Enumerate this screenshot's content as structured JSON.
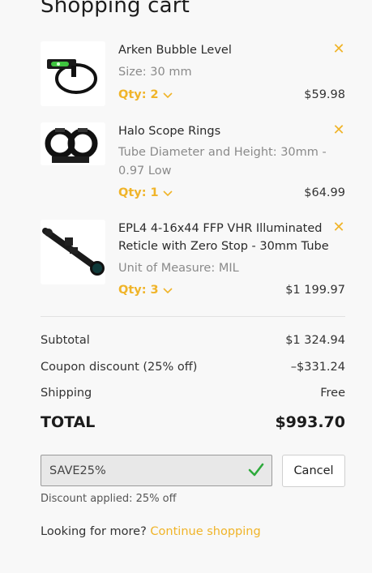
{
  "page": {
    "title": "Shopping cart"
  },
  "colors": {
    "accent": "#f0b429",
    "success": "#2eaa3c"
  },
  "cart": {
    "items": [
      {
        "name": "Arken Bubble Level",
        "attribute": "Size: 30 mm",
        "qty_label": "Qty: 2",
        "price": "$59.98",
        "thumb_icon": "bubble-level-image"
      },
      {
        "name": "Halo Scope Rings",
        "attribute": "Tube Diameter and Height: 30mm - 0.97 Low",
        "qty_label": "Qty: 1",
        "price": "$64.99",
        "thumb_icon": "scope-rings-image"
      },
      {
        "name": "EPL4 4-16x44 FFP VHR Illuminated Reticle with Zero Stop - 30mm Tube",
        "attribute": "Unit of Measure: MIL",
        "qty_label": "Qty: 3",
        "price": "$1 199.97",
        "thumb_icon": "rifle-scope-image"
      }
    ]
  },
  "summary": {
    "subtotal_label": "Subtotal",
    "subtotal_value": "$1 324.94",
    "coupon_label": "Coupon discount (25% off)",
    "coupon_value": "–$331.24",
    "shipping_label": "Shipping",
    "shipping_value": "Free",
    "total_label": "TOTAL",
    "total_value": "$993.70"
  },
  "coupon": {
    "value": "SAVE25%",
    "cancel_label": "Cancel",
    "message": "Discount applied: 25% off"
  },
  "footer": {
    "prompt": "Looking for more? ",
    "link_label": "Continue shopping"
  }
}
